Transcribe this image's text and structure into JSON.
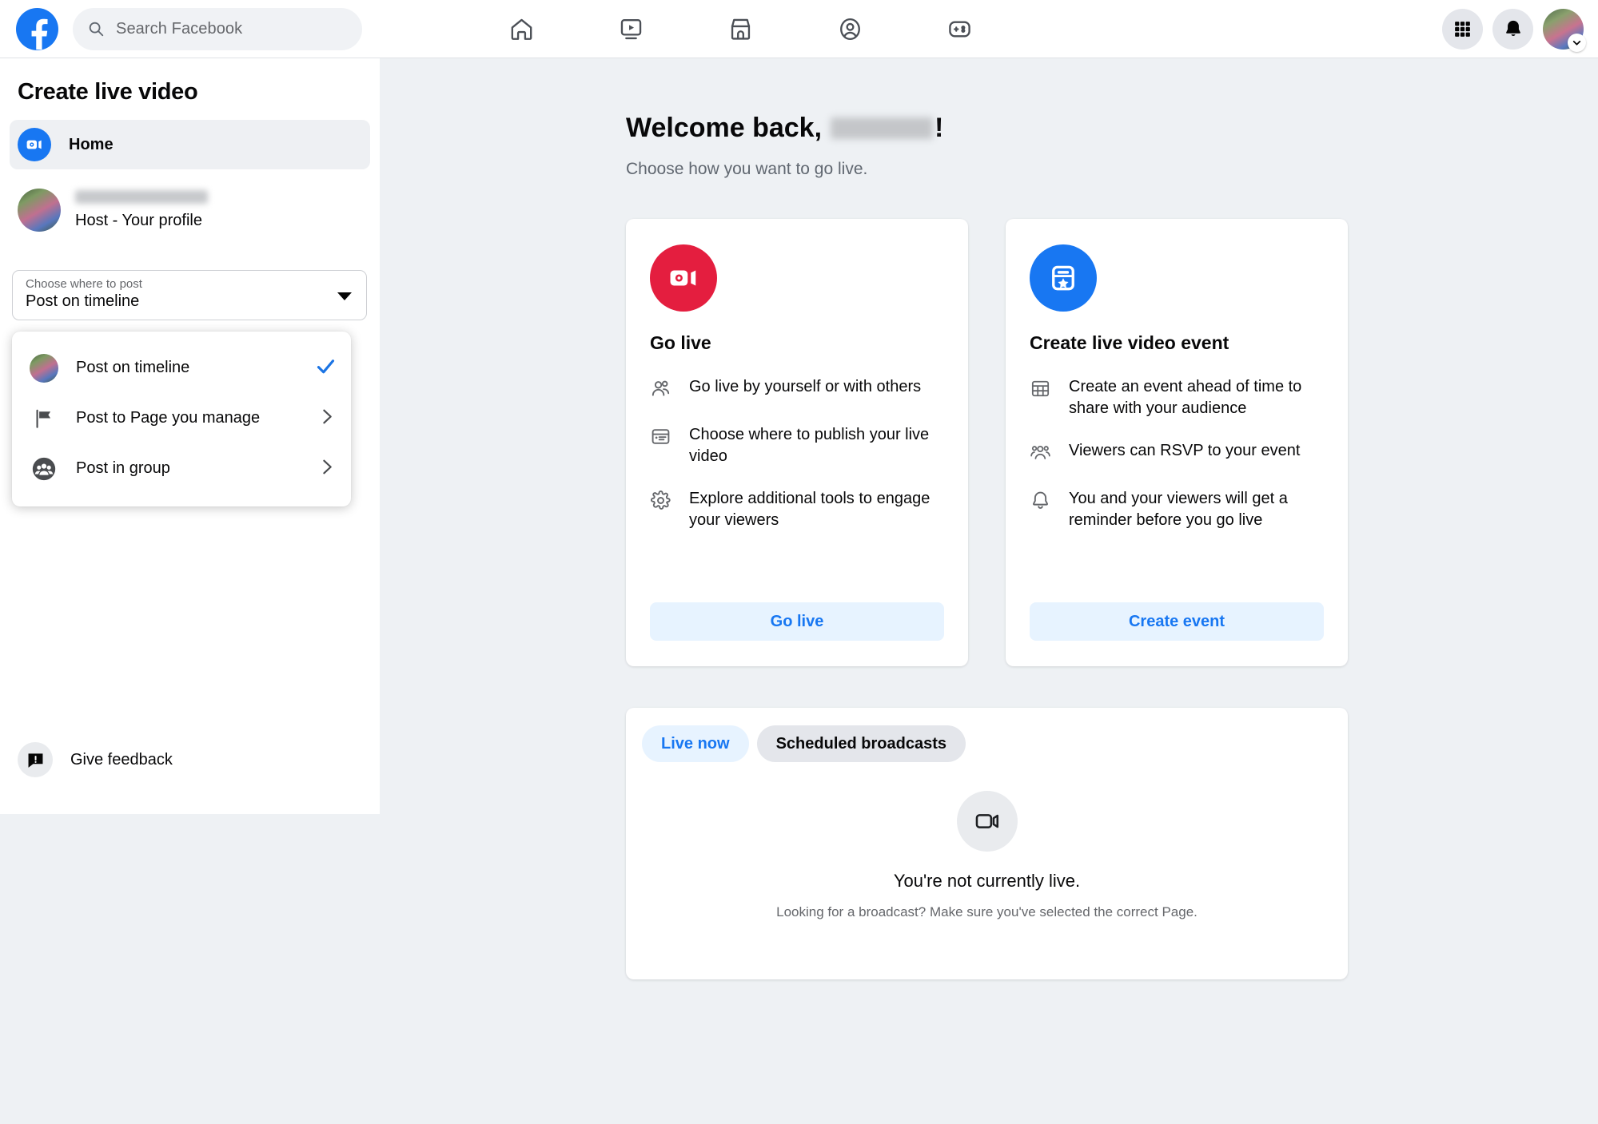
{
  "topbar": {
    "logo_icon": "facebook-logo-icon",
    "search": {
      "icon": "search-icon",
      "placeholder": "Search Facebook",
      "value": "Search Facebook"
    },
    "nav_items": [
      {
        "icon": "home-icon",
        "name": "home"
      },
      {
        "icon": "video-icon",
        "name": "video"
      },
      {
        "icon": "marketplace-icon",
        "name": "marketplace"
      },
      {
        "icon": "groups-icon",
        "name": "groups"
      },
      {
        "icon": "gaming-icon",
        "name": "gaming"
      }
    ],
    "right_items": [
      {
        "icon": "grid-menu-icon",
        "name": "menu"
      },
      {
        "icon": "bell-icon",
        "name": "notifications"
      },
      {
        "icon": "avatar",
        "name": "account"
      }
    ]
  },
  "sidebar": {
    "title": "Create live video",
    "home_item": {
      "label": "Home",
      "icon": "live-video-icon"
    },
    "profile": {
      "name_blurred": "",
      "subtitle": "Host - Your profile",
      "icon": "avatar"
    },
    "select": {
      "label": "Choose where to post",
      "value": "Post on timeline",
      "caret_icon": "chevron-down-icon"
    },
    "dropdown": {
      "options": [
        {
          "label": "Post on timeline",
          "icon": "avatar",
          "selected": true,
          "trailing": "check-icon"
        },
        {
          "label": "Post to Page you manage",
          "icon": "flag-icon",
          "selected": false,
          "trailing": "chevron-right-icon"
        },
        {
          "label": "Post in group",
          "icon": "group-icon",
          "selected": false,
          "trailing": "chevron-right-icon"
        }
      ]
    },
    "feedback": {
      "label": "Give feedback",
      "icon": "feedback-icon"
    }
  },
  "main": {
    "welcome_prefix": "Welcome back,",
    "welcome_suffix": "!",
    "welcome_subtitle": "Choose how you want to go live.",
    "cards": [
      {
        "title": "Go live",
        "badge_icon": "live-video-icon",
        "badge_color": "#e41e3f",
        "features": [
          {
            "icon": "people-icon",
            "text": "Go live by yourself or with others"
          },
          {
            "icon": "publish-window-icon",
            "text": "Choose where to publish your live video"
          },
          {
            "icon": "gear-icon",
            "text": "Explore additional tools to engage your viewers"
          }
        ],
        "action_label": "Go live"
      },
      {
        "title": "Create live video event",
        "badge_icon": "event-star-icon",
        "badge_color": "#1877f2",
        "features": [
          {
            "icon": "calendar-grid-icon",
            "text": "Create an event ahead of time to share with your audience"
          },
          {
            "icon": "group-people-icon",
            "text": "Viewers can RSVP to your event"
          },
          {
            "icon": "bell-icon",
            "text": "You and your viewers will get a reminder before you go live"
          }
        ],
        "action_label": "Create event"
      }
    ],
    "panel": {
      "tabs": [
        {
          "label": "Live now",
          "active": true
        },
        {
          "label": "Scheduled broadcasts",
          "active": false
        }
      ],
      "empty_state": {
        "icon": "video-camera-icon",
        "title": "You're not currently live.",
        "subtitle": "Looking for a broadcast? Make sure you've selected the correct Page."
      }
    }
  },
  "colors": {
    "facebook_blue": "#1877f2",
    "live_red": "#e41e3f",
    "link_blue": "#1b74e4",
    "page_bg": "#eef1f4"
  }
}
